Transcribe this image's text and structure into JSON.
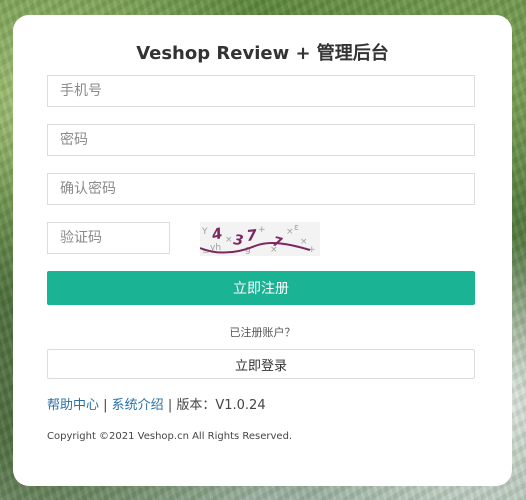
{
  "title": "Veshop Review + 管理后台",
  "form": {
    "phone_placeholder": "手机号",
    "password_placeholder": "密码",
    "confirm_password_placeholder": "确认密码",
    "captcha_placeholder": "验证码",
    "captcha_text": "4 3 7 7"
  },
  "register_button": "立即注册",
  "have_account": "已注册账户？",
  "login_button": "立即登录",
  "footer_links": {
    "help": "帮助中心",
    "sep1": " | ",
    "intro": "系统介绍",
    "sep2": " | ",
    "version_label": "版本：",
    "version": "V1.0.24"
  },
  "copyright": "Copyright ©2021 Veshop.cn All Rights Reserved.",
  "colors": {
    "accent": "#1ab394",
    "link": "#2a6fa6"
  }
}
